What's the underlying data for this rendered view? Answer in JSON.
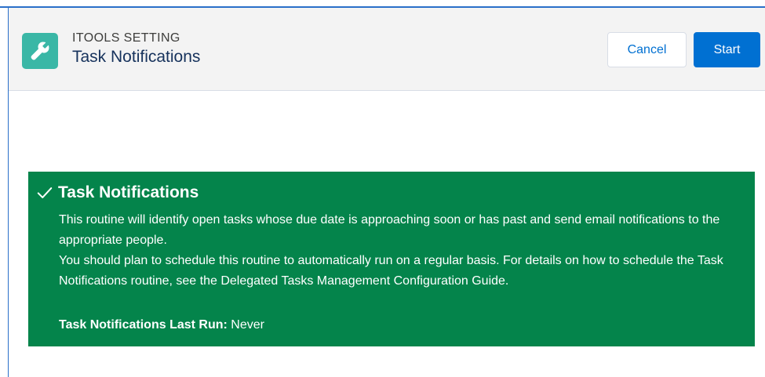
{
  "header": {
    "eyebrow": "ITOOLS SETTING",
    "title": "Task Notifications",
    "icon": "wrench-icon",
    "cancel_label": "Cancel",
    "start_label": "Start"
  },
  "banner": {
    "status_icon": "check-icon",
    "title": "Task Notifications",
    "paragraph_1": "This routine will identify open tasks whose due date is approaching soon or has past and send email notifications to the appropriate people.",
    "paragraph_2": "You should plan to schedule this routine to automatically run on a regular basis. For details on how to schedule the Task Notifications routine, see the Delegated Tasks Management Configuration Guide.",
    "last_run_label": "Task Notifications Last Run:",
    "last_run_value": "Never"
  },
  "colors": {
    "header_bg": "#f3f3f3",
    "icon_bg": "#3ab7a6",
    "primary": "#0070d2",
    "success_bg": "#04844b"
  }
}
